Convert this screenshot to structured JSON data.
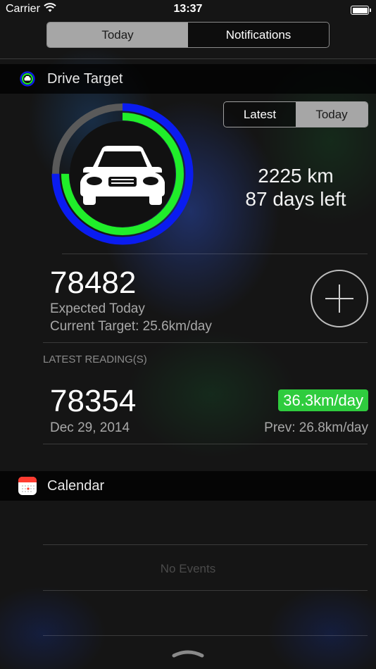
{
  "status_bar": {
    "carrier": "Carrier",
    "time": "13:37",
    "wifi_icon": "wifi-icon",
    "battery_icon": "battery-icon"
  },
  "tabs": {
    "today_label": "Today",
    "notifications_label": "Notifications",
    "selected": "Today"
  },
  "drive_target": {
    "title": "Drive Target",
    "app_icon": "car-gauge-app-icon",
    "toggle": {
      "latest_label": "Latest",
      "today_label": "Today",
      "selected": "Today"
    },
    "gauge": {
      "outer_ring_color": "#0a1cf0",
      "inner_ring_color": "#20ee2a",
      "track_color": "#5a5a5a",
      "center_icon": "car-icon"
    },
    "distance_remaining": "2225 km",
    "days_left": "87 days left",
    "expected_value": "78482",
    "expected_label": "Expected Today",
    "current_target": "Current Target: 25.6km/day",
    "add_button_icon": "plus-icon",
    "latest_readings_header": "LATEST READING(S)",
    "latest_reading": {
      "value": "78354",
      "date": "Dec 29, 2014",
      "rate": "36.3km/day",
      "rate_color": "#2fcc3e",
      "previous": "Prev: 26.8km/day"
    }
  },
  "calendar": {
    "title": "Calendar",
    "app_icon": "calendar-icon",
    "empty_message": "No Events"
  },
  "footer": {
    "handle_icon": "pull-handle-icon"
  }
}
